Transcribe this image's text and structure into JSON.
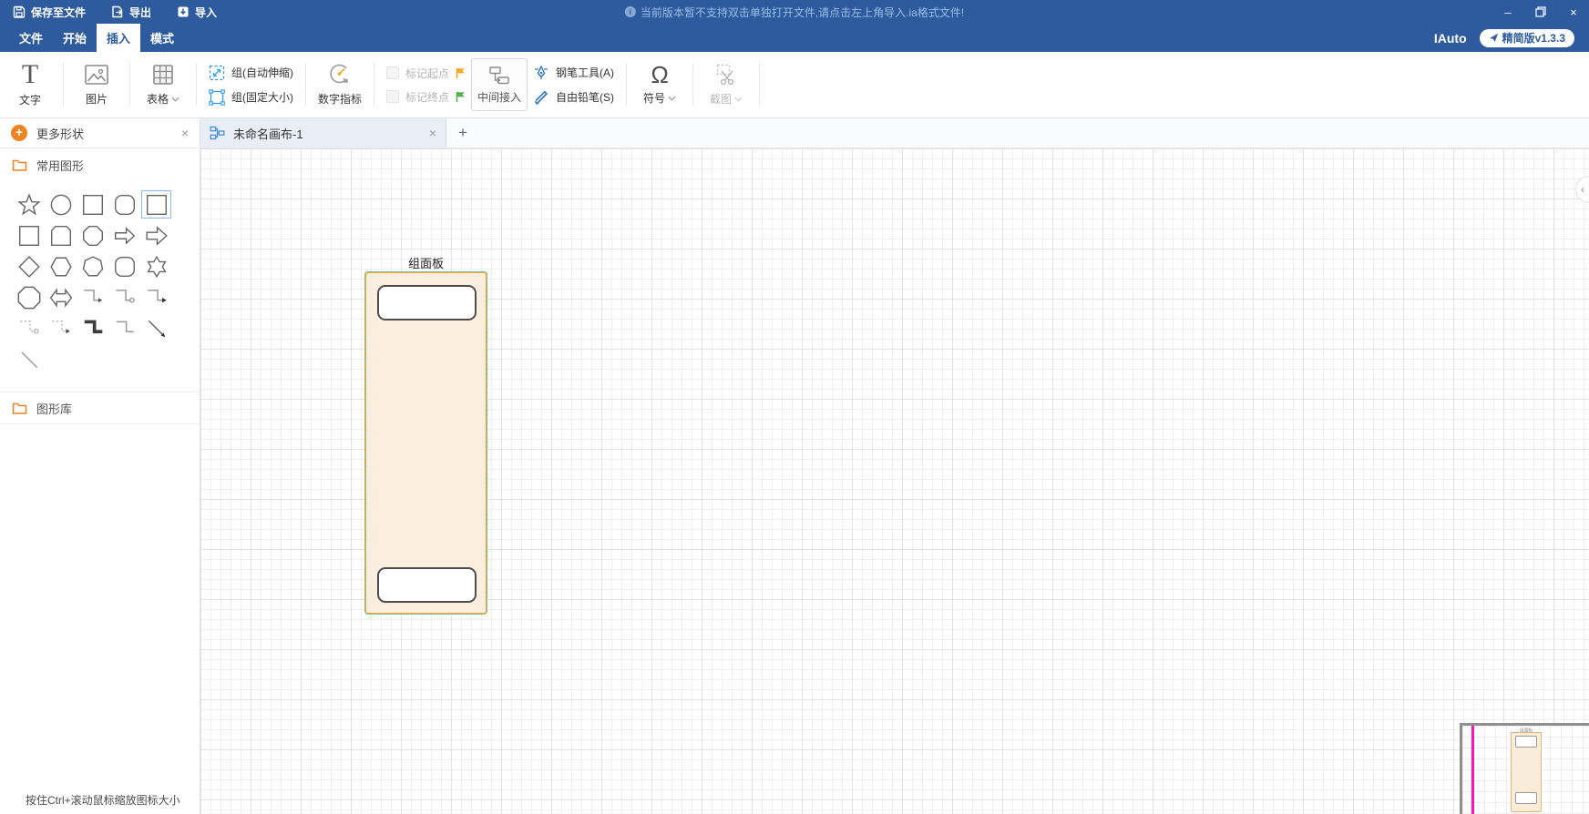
{
  "app": {
    "brand": "IAuto",
    "version_badge": "精简版v1.3.3"
  },
  "titlebar": {
    "save_label": "保存至文件",
    "export_label": "导出",
    "import_label": "导入",
    "notice": "当前版本暂不支持双击单独打开文件,请点击左上角导入.ia格式文件!"
  },
  "menubar": {
    "tabs": [
      {
        "label": "文件",
        "active": false
      },
      {
        "label": "开始",
        "active": false
      },
      {
        "label": "插入",
        "active": true
      },
      {
        "label": "模式",
        "active": false
      }
    ]
  },
  "toolbar": {
    "text_label": "文字",
    "image_label": "图片",
    "table_label": "表格",
    "group_auto_label": "组(自动伸缩)",
    "group_fixed_label": "组(固定大小)",
    "numeric_label": "数字指标",
    "mark_start_label": "标记起点",
    "mark_end_label": "标记终点",
    "middle_access_label": "中间接入",
    "pen_label": "钢笔工具(A)",
    "pencil_label": "自由铅笔(S)",
    "symbol_label": "符号",
    "screenshot_label": "截图"
  },
  "sidebar": {
    "header_label": "更多形状",
    "section_common": "常用图形",
    "section_library": "图形库",
    "status_hint": "按住Ctrl+滚动鼠标缩放图标大小",
    "shapes": [
      {
        "type": "star-5"
      },
      {
        "type": "circle"
      },
      {
        "type": "square"
      },
      {
        "type": "rounded-square"
      },
      {
        "type": "square",
        "selected": true
      },
      {
        "type": "square"
      },
      {
        "type": "chamfer-square"
      },
      {
        "type": "octagon"
      },
      {
        "type": "arrow-right"
      },
      {
        "type": "arrow-right-bold"
      },
      {
        "type": "diamond"
      },
      {
        "type": "hexagon"
      },
      {
        "type": "heptagon"
      },
      {
        "type": "rounded-square"
      },
      {
        "type": "star-6"
      },
      {
        "type": "octagon-large"
      },
      {
        "type": "double-arrow"
      },
      {
        "type": "elbow-arrow"
      },
      {
        "type": "elbow-circle"
      },
      {
        "type": "elbow-arrow-solid"
      },
      {
        "type": "elbow-dashed-circle"
      },
      {
        "type": "elbow-dashed-arrow"
      },
      {
        "type": "elbow-thick"
      },
      {
        "type": "elbow-plain"
      },
      {
        "type": "line-arrow"
      },
      {
        "type": "line"
      }
    ]
  },
  "canvas": {
    "tab_title": "未命名画布-1",
    "group_panel_label": "组面板",
    "minimap_label": "组面板"
  },
  "icons": {
    "omega": "Ω",
    "text_tool": "T",
    "minimize": "–",
    "close": "×",
    "tab_close": "×",
    "panel_close": "×",
    "add_tab": "+",
    "collapse": "‹",
    "plus": "+",
    "info": "i"
  },
  "colors": {
    "titlebar_blue": "#2d5b9e",
    "accent_blue": "#2e9bf0",
    "orange": "#f08324",
    "flag_start": "#f5a623",
    "flag_end": "#52b153",
    "group_fill": "#fbeede",
    "group_border": "#f0a732",
    "selection_dash": "#45d0e8",
    "minimap_line": "#ff10c0"
  }
}
